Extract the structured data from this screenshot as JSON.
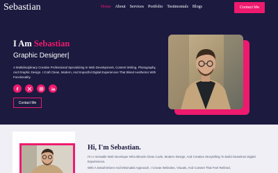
{
  "brand": "Sebastian",
  "nav": {
    "items": [
      "Home",
      "About",
      "Services",
      "Portfolio",
      "Testimonials",
      "Blogs"
    ],
    "active": "Home",
    "cta_label": "Contact Me"
  },
  "hero": {
    "greeting": "I Am ",
    "name": "Sebastian",
    "role": "Graphic Designer|",
    "description": "A Multidisciplinary Creative Professional Specializing In Web Development, Content Writing, Photography, And Graphic Design. I Craft Clean, Modern, And Impactful Digital Experiences That Blend Aesthetics With Functionality.",
    "socials": [
      "facebook-icon",
      "x-icon",
      "instagram-icon",
      "linkedin-icon"
    ],
    "contact_label": "Contact Me"
  },
  "about": {
    "title": "Hi, I'm Sebastian.",
    "paragraph1": "I'm A Versatile Web Developer Who Blends Clean Code, Modern Design, And Creative Storytelling To Build Seamless Digital Experiences.",
    "paragraph2": "With A Detail-Driven And Minimalist Approach, I Create Websites, Visuals, And Content That Feel Refined,"
  },
  "colors": {
    "background": "#1c1a3f",
    "accent": "#ee1a6e",
    "about_background": "#efeff5"
  }
}
